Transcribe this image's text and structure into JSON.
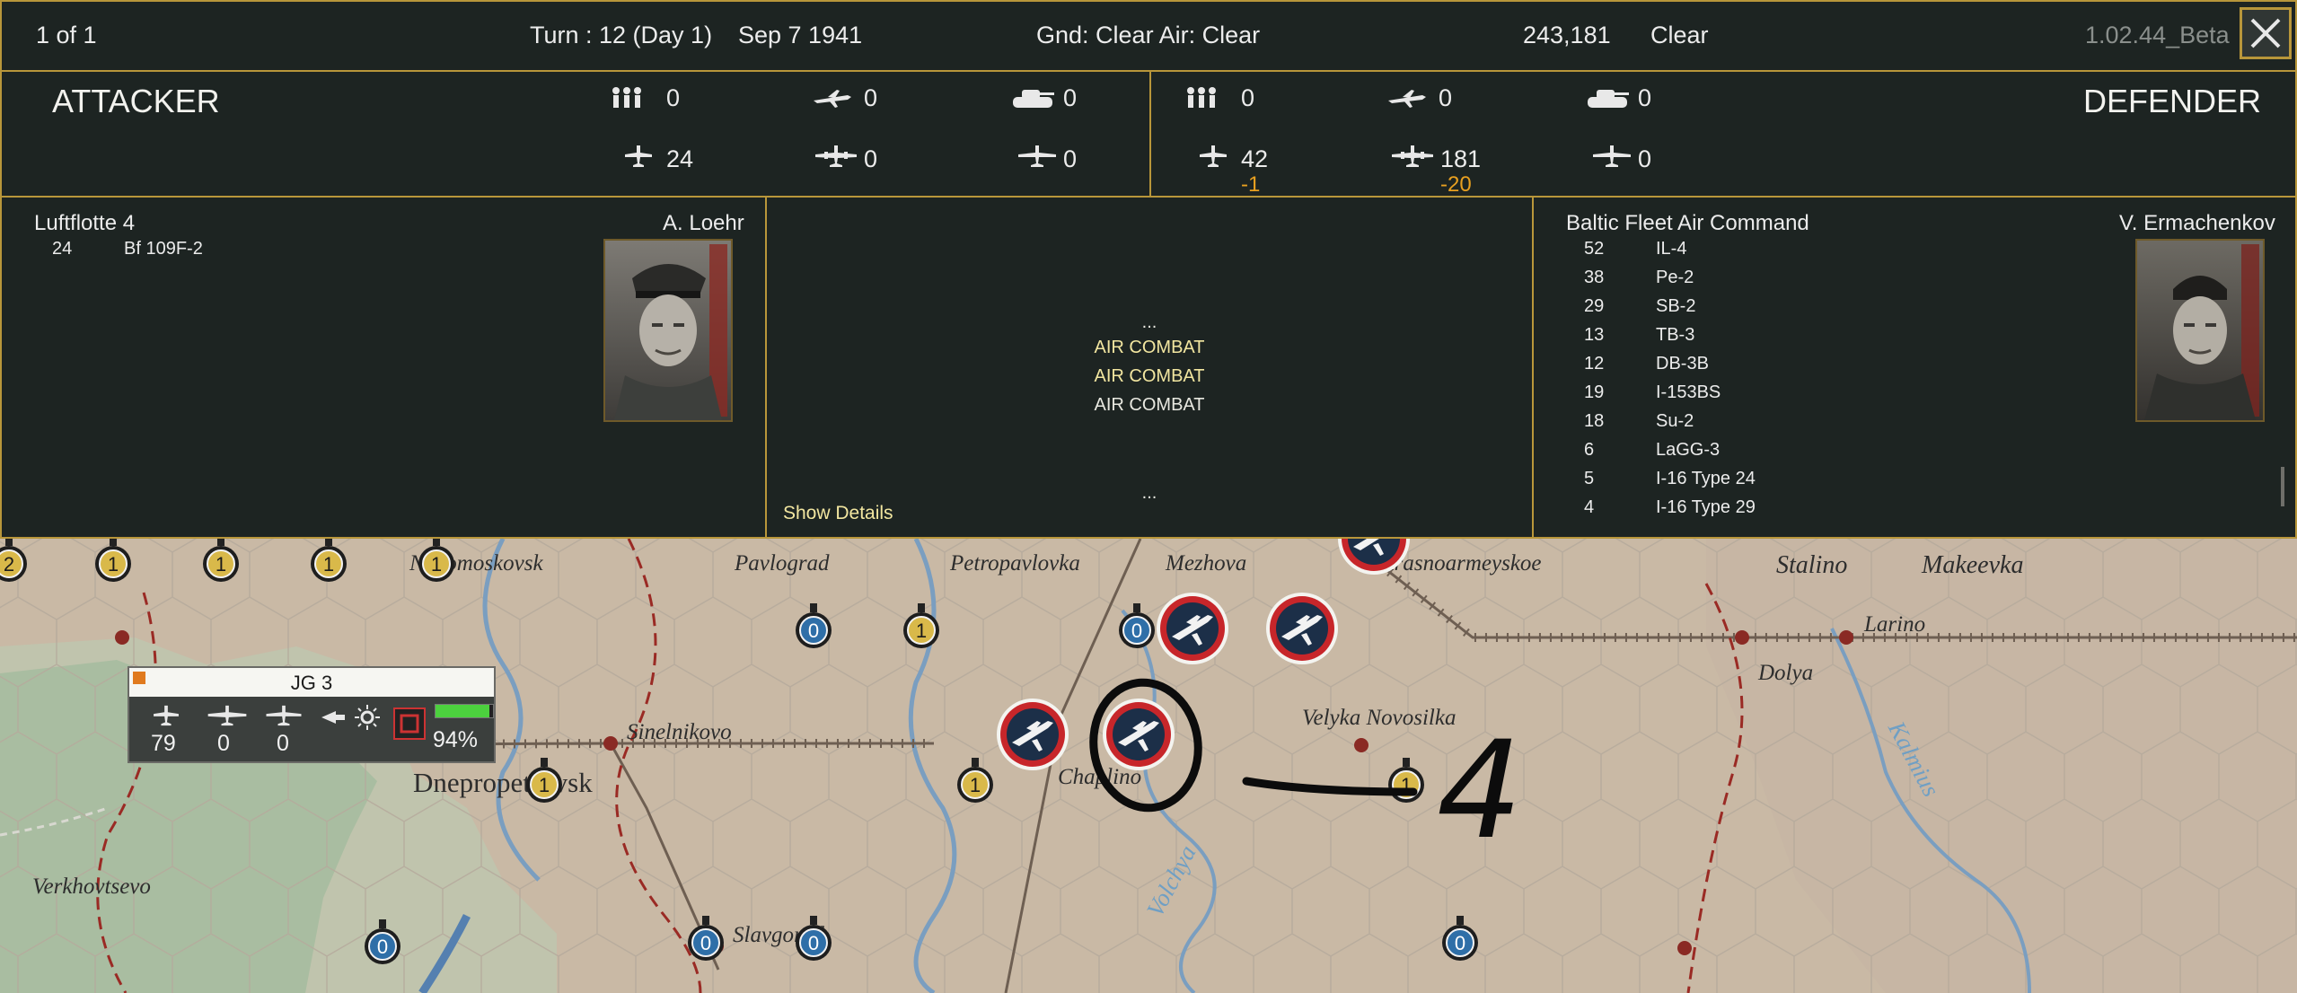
{
  "topbar": {
    "pager": "1 of 1",
    "turn": "Turn : 12 (Day 1)",
    "date": "Sep 7 1941",
    "weather": "Gnd: Clear  Air: Clear",
    "coords": "243,181",
    "terrain": "Clear",
    "version": "1.02.44_Beta"
  },
  "summary": {
    "attacker_label": "ATTACKER",
    "defender_label": "DEFENDER",
    "attacker": {
      "infantry": "0",
      "fighter_bomber": "0",
      "armor": "0",
      "fighters": "24",
      "bombers": "0",
      "recon": "0"
    },
    "defender": {
      "infantry": "0",
      "fighter_bomber": "0",
      "armor": "0",
      "fighters": "42",
      "fighters_loss": "-1",
      "bombers": "181",
      "bombers_loss": "-20",
      "recon": "0"
    }
  },
  "attacker_cmd": {
    "name": "Luftflotte 4",
    "leader": "A. Loehr",
    "units": [
      {
        "count": "24",
        "type": "Bf 109F-2"
      }
    ]
  },
  "defender_cmd": {
    "name": "Baltic Fleet Air Command",
    "leader": "V. Ermachenkov",
    "units": [
      {
        "count": "52",
        "type": "IL-4"
      },
      {
        "count": "38",
        "type": "Pe-2"
      },
      {
        "count": "29",
        "type": "SB-2"
      },
      {
        "count": "13",
        "type": "TB-3"
      },
      {
        "count": "12",
        "type": "DB-3B"
      },
      {
        "count": "19",
        "type": "I-153BS"
      },
      {
        "count": "18",
        "type": "Su-2"
      },
      {
        "count": "6",
        "type": "LaGG-3"
      },
      {
        "count": "5",
        "type": "I-16 Type 24"
      },
      {
        "count": "4",
        "type": "I-16 Type 29"
      }
    ]
  },
  "combat_log": {
    "ellipsis_top": "...",
    "lines": [
      "AIR COMBAT",
      "AIR COMBAT",
      "AIR COMBAT"
    ],
    "ellipsis_bottom": "...",
    "show_details": "Show Details"
  },
  "map": {
    "towns": {
      "novomoskovsk": "Novomoskovsk",
      "pavlograd": "Pavlograd",
      "petropavlovka": "Petropavlovka",
      "mezhova": "Mezhova",
      "krasnoarmeyskoe": "Krasnoarmeyskoe",
      "stalino": "Stalino",
      "makeevka": "Makeevka",
      "larino": "Larino",
      "dolya": "Dolya",
      "sinelnikovo": "Sinelnikovo",
      "dnepropetrovsk": "Dnepropetrovsk",
      "chaplino": "Chaplino",
      "velyka_novosilka": "Velyka Novosilka",
      "verkhovtsevo": "Verkhovtsevo",
      "slavgorod": "Slavgorod"
    },
    "rivers": {
      "volchya": "Volchya",
      "kalmius": "Kalmius"
    },
    "markers": [
      "2",
      "1",
      "1",
      "1",
      "1",
      "0",
      "1",
      "0",
      "1",
      "1",
      "1",
      "0",
      "0",
      "0",
      "0"
    ],
    "annotation": "4"
  },
  "unit_card": {
    "name": "JG 3",
    "fighters": "79",
    "bombers": "0",
    "recon": "0",
    "readiness": "94%",
    "readiness_level": 0.94
  },
  "colors": {
    "gold": "#b8963a",
    "loss": "#e8a020",
    "highlight": "#f2e6a0"
  }
}
